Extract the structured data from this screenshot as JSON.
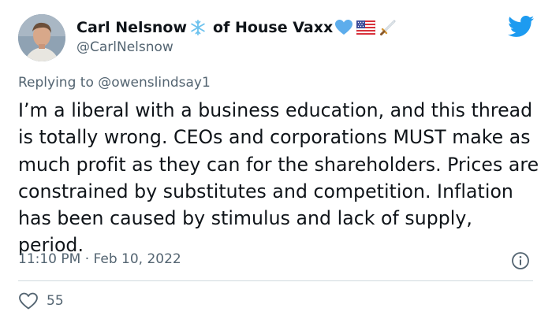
{
  "tweet": {
    "display_name": "Carl Nelsnow",
    "display_name_suffix": "of House Vaxx",
    "handle": "@CarlNelsnow",
    "reply_prefix": "Replying to",
    "reply_to": "@owenslindsay1",
    "body": "I’m a liberal with a business education, and this thread is totally wrong. CEOs and corporations MUST make as much profit as they can for the shareholders. Prices are constrained by substitutes and competition. Inflation has been caused by stimulus and lack of supply, period.",
    "timestamp": "11:10 PM · Feb 10, 2022",
    "like_count": "55"
  },
  "icons": {
    "name_icons": [
      "snowflake-icon",
      "blue-heart-icon",
      "us-flag-icon",
      "dagger-icon"
    ],
    "logo": "twitter-bird-icon",
    "info": "info-icon",
    "like": "heart-outline-icon"
  },
  "colors": {
    "twitter_blue": "#1d9bf0",
    "secondary_text": "#536471",
    "primary_text": "#0f1419",
    "divider": "#cfd9de"
  }
}
